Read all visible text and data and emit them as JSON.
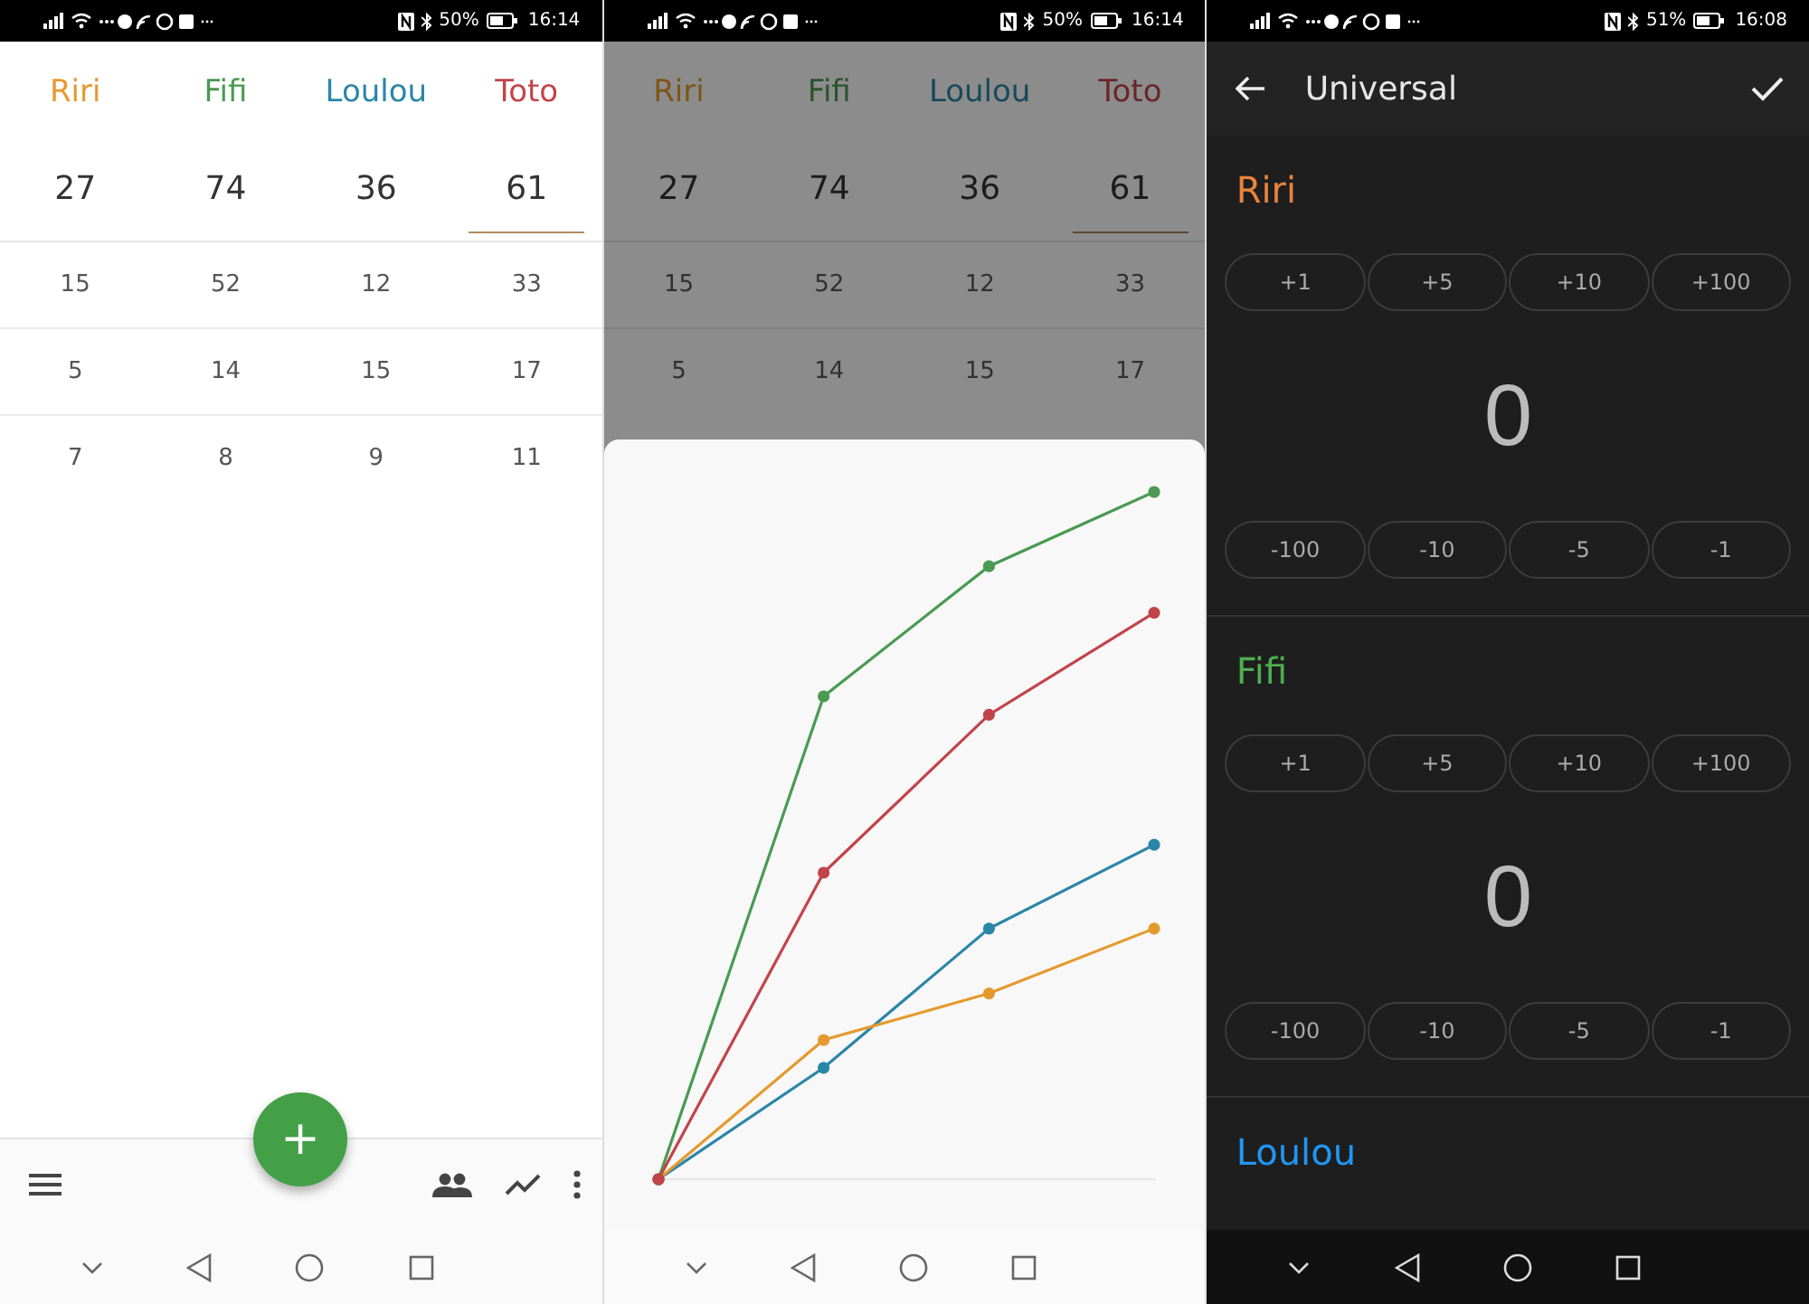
{
  "screens": [
    {
      "kind": "scores",
      "status_bar": {
        "battery": "50%",
        "time": "16:14"
      },
      "players": [
        {
          "name": "Riri",
          "color": "#e59a2f",
          "total": "27",
          "selected": false
        },
        {
          "name": "Fifi",
          "color": "#4a9a52",
          "total": "74",
          "selected": false
        },
        {
          "name": "Loulou",
          "color": "#2a86a8",
          "total": "36",
          "selected": false
        },
        {
          "name": "Toto",
          "color": "#c2444a",
          "total": "61",
          "selected": true
        }
      ],
      "rows": [
        [
          "15",
          "52",
          "12",
          "33"
        ],
        [
          "5",
          "14",
          "15",
          "17"
        ],
        [
          "7",
          "8",
          "9",
          "11"
        ]
      ],
      "fab": "+"
    },
    {
      "kind": "scores",
      "status_bar": {
        "battery": "50%",
        "time": "16:14"
      },
      "players": [
        {
          "name": "Riri",
          "color": "#7e5519",
          "total": "27",
          "selected": false
        },
        {
          "name": "Fifi",
          "color": "#29552d",
          "total": "74",
          "selected": false
        },
        {
          "name": "Loulou",
          "color": "#174a5c",
          "total": "36",
          "selected": false
        },
        {
          "name": "Toto",
          "color": "#6b2529",
          "total": "61",
          "selected": true
        }
      ],
      "rows": [
        [
          "15",
          "52",
          "12",
          "33"
        ],
        [
          "5",
          "14",
          "15",
          "17"
        ]
      ],
      "dimmed": true,
      "sheet": {
        "kind": "chart"
      }
    },
    {
      "kind": "editor",
      "status_bar": {
        "battery": "51%",
        "time": "16:08"
      },
      "title": "Universal",
      "players": [
        {
          "name": "Riri",
          "color": "#e8843c",
          "add": [
            "+1",
            "+5",
            "+10",
            "+100"
          ],
          "value": "0",
          "subtract": [
            "-100",
            "-10",
            "-5",
            "-1"
          ]
        },
        {
          "name": "Fifi",
          "color": "#4caf50",
          "add": [
            "+1",
            "+5",
            "+10",
            "+100"
          ],
          "value": "0",
          "subtract": [
            "-100",
            "-10",
            "-5",
            "-1"
          ]
        },
        {
          "name": "Loulou",
          "color": "#2196f3"
        }
      ]
    }
  ]
}
